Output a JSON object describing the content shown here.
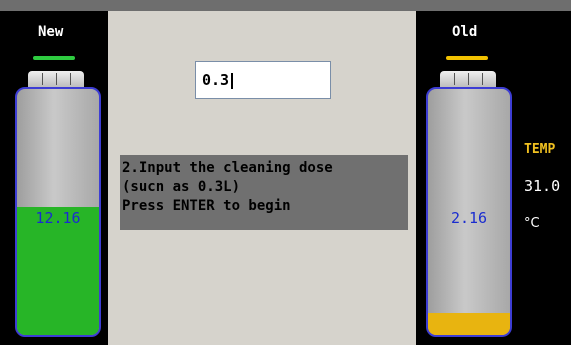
{
  "new_tank": {
    "title": "New",
    "value": "12.16",
    "level": 0.52,
    "fill_color": "#27b527",
    "indicator_color": "#2ecc40",
    "value_color": "#1a2ccf"
  },
  "old_tank": {
    "title": "Old",
    "value": "2.16",
    "level": 0.09,
    "fill_color": "#e8b410",
    "indicator_color": "#f2c200",
    "value_color": "#1a2ccf"
  },
  "dose_input": {
    "value": "0.3"
  },
  "instruction": {
    "line1": "2.Input the cleaning dose",
    "line2": "(sucn as 0.3L)",
    "line3": "Press ENTER to begin"
  },
  "temperature": {
    "label": "TEMP",
    "value": "31.0",
    "unit": "°C"
  }
}
